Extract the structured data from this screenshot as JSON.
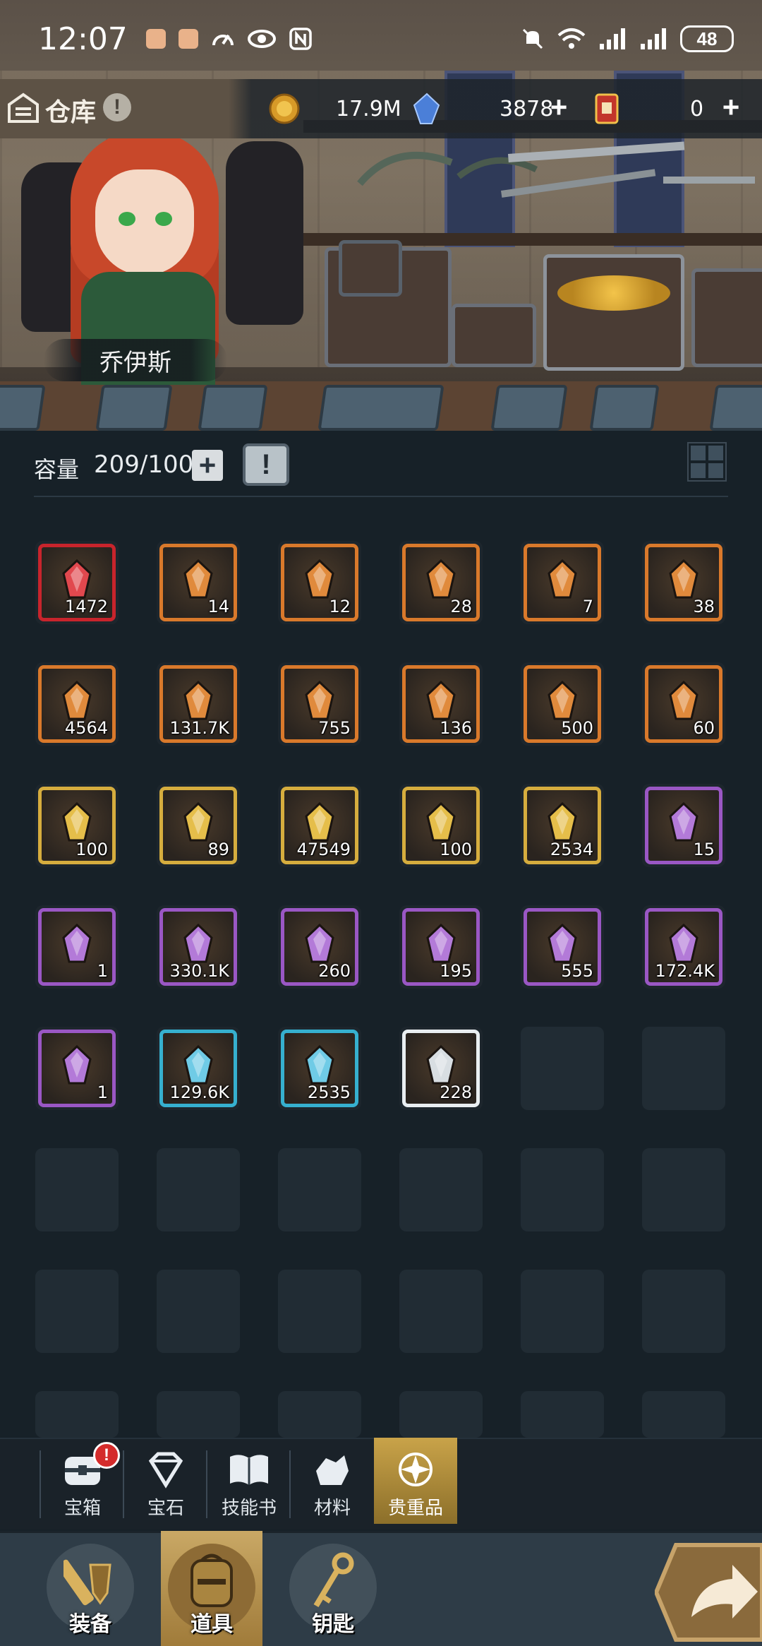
{
  "status_bar": {
    "time": "12:07",
    "battery": "48"
  },
  "header": {
    "title": "仓库",
    "gold": "17.9M",
    "gems": "3878",
    "tickets": "0"
  },
  "hero": {
    "name": "乔伊斯"
  },
  "inventory": {
    "capacity_label": "容量",
    "capacity_value": "209/100",
    "items": [
      {
        "count": "1472",
        "rarity": "red",
        "icon": "red-crystal-icon"
      },
      {
        "count": "14",
        "rarity": "orange",
        "icon": "green-scepter-icon"
      },
      {
        "count": "12",
        "rarity": "orange",
        "icon": "crystal-goblet-icon"
      },
      {
        "count": "28",
        "rarity": "orange",
        "icon": "purple-wand-icon"
      },
      {
        "count": "7",
        "rarity": "orange",
        "icon": "emblem-shield-icon"
      },
      {
        "count": "38",
        "rarity": "orange",
        "icon": "winged-medal-icon"
      },
      {
        "count": "4564",
        "rarity": "orange",
        "icon": "orange-crystal-icon"
      },
      {
        "count": "131.7K",
        "rarity": "orange",
        "icon": "purple-crystal-icon"
      },
      {
        "count": "755",
        "rarity": "orange",
        "icon": "bear-token-icon"
      },
      {
        "count": "136",
        "rarity": "orange",
        "icon": "seed-pouch-icon"
      },
      {
        "count": "500",
        "rarity": "orange",
        "icon": "paw-badge-icon"
      },
      {
        "count": "60",
        "rarity": "orange",
        "icon": "scroll-tube-icon"
      },
      {
        "count": "100",
        "rarity": "gold",
        "icon": "sword-shield-icon"
      },
      {
        "count": "89",
        "rarity": "gold",
        "icon": "star-shard-icon"
      },
      {
        "count": "47549",
        "rarity": "gold",
        "icon": "gold-crystal-icon"
      },
      {
        "count": "100",
        "rarity": "gold",
        "icon": "crowned-gem-icon"
      },
      {
        "count": "2534",
        "rarity": "gold",
        "icon": "flame-essence-icon"
      },
      {
        "count": "15",
        "rarity": "purple",
        "icon": "bread-icon"
      },
      {
        "count": "1",
        "rarity": "purple",
        "icon": "potion-flask-icon"
      },
      {
        "count": "330.1K",
        "rarity": "purple",
        "icon": "map-scroll-icon"
      },
      {
        "count": "260",
        "rarity": "purple",
        "icon": "golden-key-icon"
      },
      {
        "count": "195",
        "rarity": "purple",
        "icon": "cauldron-icon"
      },
      {
        "count": "555",
        "rarity": "purple",
        "icon": "stone-ring-icon"
      },
      {
        "count": "172.4K",
        "rarity": "purple",
        "icon": "claw-fragment-icon"
      },
      {
        "count": "1",
        "rarity": "purple",
        "icon": "wooden-box-icon"
      },
      {
        "count": "129.6K",
        "rarity": "cyan",
        "icon": "ice-crystal-icon"
      },
      {
        "count": "2535",
        "rarity": "cyan",
        "icon": "lava-rock-icon"
      },
      {
        "count": "228",
        "rarity": "white",
        "icon": "red-potion-icon"
      }
    ]
  },
  "sub_tabs": [
    {
      "label": "宝箱",
      "icon": "chest-icon",
      "badge": "!"
    },
    {
      "label": "宝石",
      "icon": "diamond-icon"
    },
    {
      "label": "技能书",
      "icon": "book-icon"
    },
    {
      "label": "材料",
      "icon": "ore-icon"
    },
    {
      "label": "贵重品",
      "icon": "star-emblem-icon"
    }
  ],
  "bottom_nav": [
    {
      "label": "装备",
      "icon": "equipment-icon"
    },
    {
      "label": "道具",
      "icon": "backpack-icon"
    },
    {
      "label": "钥匙",
      "icon": "key-icon"
    }
  ],
  "colors": {
    "red": "#c8242c",
    "orange": "#d9792b",
    "gold": "#d6ad3e",
    "purple": "#9a57c4",
    "cyan": "#36b0cf",
    "white": "#e9eef1",
    "accent": "#c9a349"
  }
}
